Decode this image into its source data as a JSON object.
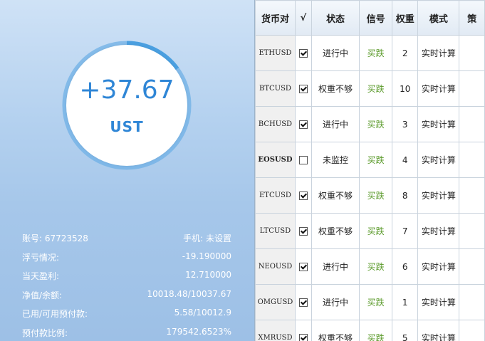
{
  "summary": {
    "profit": "+37.67",
    "currency": "UST",
    "gauge_fraction": 0.15,
    "gauge_color": "#4a9fe0"
  },
  "stats": [
    {
      "label": "账号: 67723528",
      "value": "手机: 未设置"
    },
    {
      "label": "浮亏情况:",
      "value": "-19.190000"
    },
    {
      "label": "当天盈利:",
      "value": "12.710000"
    },
    {
      "label": "净值/余额:",
      "value": "10018.48/10037.67"
    },
    {
      "label": "已用/可用预付款:",
      "value": "5.58/10012.9"
    },
    {
      "label": "预付款比例:",
      "value": "179542.6523%"
    }
  ],
  "table": {
    "headers": [
      "货币对",
      "√",
      "状态",
      "信号",
      "权重",
      "模式",
      "策"
    ],
    "rows": [
      {
        "pair": "ETHUSD",
        "checked": true,
        "status": "进行中",
        "signal": "买跌",
        "weight": "2",
        "mode": "实时计算"
      },
      {
        "pair": "BTCUSD",
        "checked": true,
        "status": "权重不够",
        "signal": "买跌",
        "weight": "10",
        "mode": "实时计算"
      },
      {
        "pair": "BCHUSD",
        "checked": true,
        "status": "进行中",
        "signal": "买跌",
        "weight": "3",
        "mode": "实时计算"
      },
      {
        "pair": "EOSUSD",
        "checked": false,
        "status": "未监控",
        "signal": "买跌",
        "weight": "4",
        "mode": "实时计算"
      },
      {
        "pair": "ETCUSD",
        "checked": true,
        "status": "权重不够",
        "signal": "买跌",
        "weight": "8",
        "mode": "实时计算"
      },
      {
        "pair": "LTCUSD",
        "checked": true,
        "status": "权重不够",
        "signal": "买跌",
        "weight": "7",
        "mode": "实时计算"
      },
      {
        "pair": "NEOUSD",
        "checked": true,
        "status": "进行中",
        "signal": "买跌",
        "weight": "6",
        "mode": "实时计算"
      },
      {
        "pair": "OMGUSD",
        "checked": true,
        "status": "进行中",
        "signal": "买跌",
        "weight": "1",
        "mode": "实时计算"
      },
      {
        "pair": "XMRUSD",
        "checked": true,
        "status": "权重不够",
        "signal": "买跌",
        "weight": "5",
        "mode": "实时计算"
      }
    ]
  }
}
